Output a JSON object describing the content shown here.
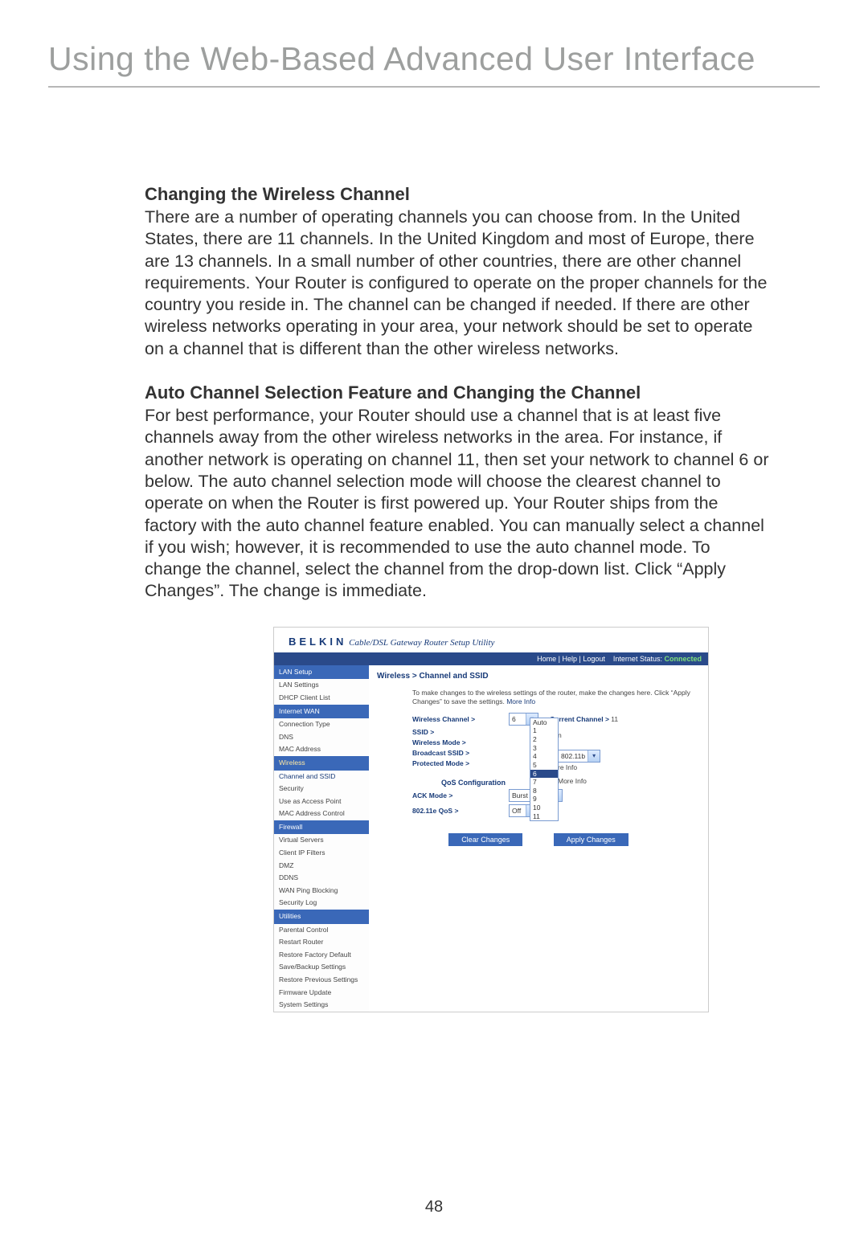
{
  "page": {
    "title": "Using the Web-Based Advanced User Interface",
    "number": "48"
  },
  "sections": {
    "s1_heading": "Changing the Wireless Channel",
    "s1_body": "There are a number of operating channels you can choose from. In the United States, there are 11 channels. In the United Kingdom and most of Europe, there are 13 channels. In a small number of other countries, there are other channel requirements. Your Router is configured to operate on the proper channels for the country you reside in. The channel can be changed if needed. If there are other wireless networks operating in your area, your network should be set to operate on a channel that is different than the other wireless networks.",
    "s2_heading": "Auto Channel Selection Feature and Changing the Channel",
    "s2_body": "For best performance, your Router should use a channel that is at least five channels away from the other wireless networks in the area. For instance, if another network is operating on channel 11, then set your network to channel 6 or below. The auto channel selection mode will choose the clearest channel to operate on when the Router is first powered up. Your Router ships from the factory with the auto channel feature enabled. You can manually select a channel if you wish; however, it is recommended to use the auto channel mode. To change the channel, select the channel from the drop-down list. Click “Apply Changes”. The change is immediate."
  },
  "router": {
    "brand": "BELKIN",
    "subtitle": "Cable/DSL Gateway Router Setup Utility",
    "topbar_links": "Home | Help | Logout",
    "topbar_status_label": "Internet Status:",
    "topbar_status_value": "Connected",
    "breadcrumb": "Wireless > Channel and SSID",
    "intro": "To make changes to the wireless settings of the router, make the changes here. Click “Apply Changes” to save the settings.",
    "more_info": "More Info",
    "form": {
      "wireless_channel_label": "Wireless Channel >",
      "wireless_channel_value": "6",
      "current_channel_label": "Current Channel >",
      "current_channel_value": "11",
      "ssid_label": "SSID >",
      "ssid_value": "n",
      "wireless_mode_label": "Wireless Mode >",
      "wireless_mode_value": "802.11b",
      "broadcast_label": "Broadcast SSID >",
      "broadcast_hint": "re Info",
      "protected_label": "Protected Mode >",
      "protected_hint": "More Info",
      "qos_header": "QoS Configuration",
      "ack_label": "ACK Mode >",
      "ack_value": "Burst ACK",
      "qos_label": "802.11e QoS >",
      "qos_value": "Off"
    },
    "dropdown": {
      "items": [
        "Auto",
        "1",
        "2",
        "3",
        "4",
        "5",
        "6",
        "7",
        "8",
        "9",
        "10",
        "11"
      ],
      "highlight_index": 6
    },
    "buttons": {
      "clear": "Clear Changes",
      "apply": "Apply Changes"
    },
    "sidebar": {
      "groups": [
        {
          "head": "LAN Setup",
          "headClass": "",
          "items": [
            "LAN Settings",
            "DHCP Client List"
          ]
        },
        {
          "head": "Internet WAN",
          "headClass": "",
          "items": [
            "Connection Type",
            "DNS",
            "MAC Address"
          ]
        },
        {
          "head": "Wireless",
          "headClass": "wireless",
          "items": [
            "Channel and SSID",
            "Security",
            "Use as Access Point",
            "MAC Address Control"
          ]
        },
        {
          "head": "Firewall",
          "headClass": "",
          "items": [
            "Virtual Servers",
            "Client IP Filters",
            "DMZ",
            "DDNS",
            "WAN Ping Blocking",
            "Security Log"
          ]
        },
        {
          "head": "Utilities",
          "headClass": "",
          "items": [
            "Parental Control",
            "Restart Router",
            "Restore Factory Default",
            "Save/Backup Settings",
            "Restore Previous Settings",
            "Firmware Update",
            "System Settings"
          ]
        }
      ]
    }
  }
}
